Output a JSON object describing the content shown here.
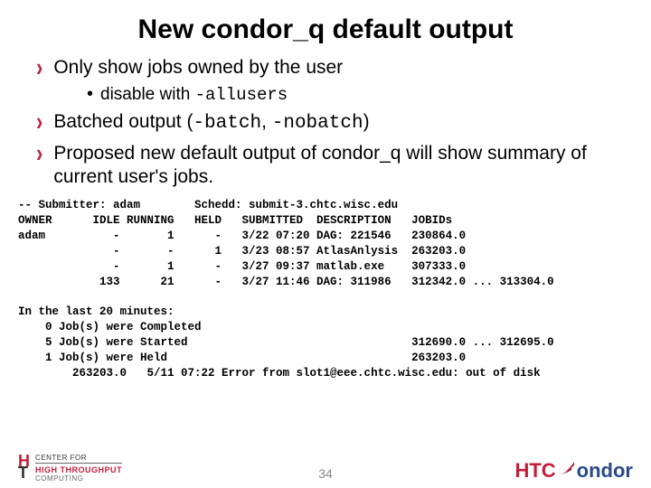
{
  "title": "New condor_q default output",
  "bullets": {
    "b1": "Only show jobs owned by the user",
    "b1_sub_prefix": "disable with ",
    "b1_sub_code": "-allusers",
    "b2_prefix": "Batched output (",
    "b2_code1": "-batch",
    "b2_mid": ", ",
    "b2_code2": "-nobatch",
    "b2_suffix": ")",
    "b3": "Proposed new default output of condor_q will show summary of current user's jobs."
  },
  "terminal": "-- Submitter: adam        Schedd: submit-3.chtc.wisc.edu\nOWNER      IDLE RUNNING   HELD   SUBMITTED  DESCRIPTION   JOBIDs\nadam          -       1      -   3/22 07:20 DAG: 221546   230864.0\n              -       -      1   3/23 08:57 AtlasAnlysis  263203.0\n              -       1      -   3/27 09:37 matlab.exe    307333.0\n            133      21      -   3/27 11:46 DAG: 311986   312342.0 ... 313304.0\n\nIn the last 20 minutes:\n    0 Job(s) were Completed\n    5 Job(s) were Started                                 312690.0 ... 312695.0\n    1 Job(s) were Held                                    263203.0\n        263203.0   5/11 07:22 Error from slot1@eee.chtc.wisc.edu: out of disk",
  "footer": {
    "left_center": "CENTER FOR",
    "left_line1": "HIGH THROUGHPUT",
    "left_line2": "COMPUTING",
    "right_ht": "HTC",
    "right_ondor": "ondor",
    "page": "34"
  }
}
